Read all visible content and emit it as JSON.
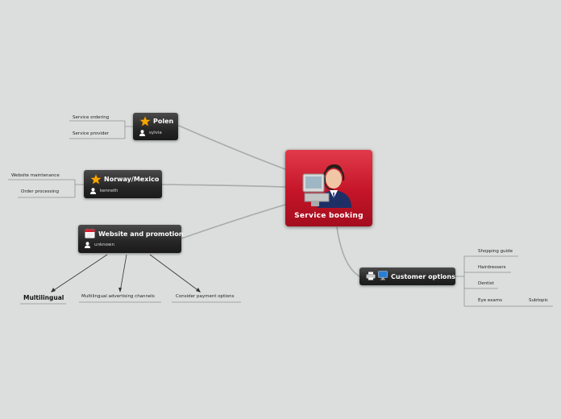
{
  "center": {
    "title": "Service  booking",
    "icon": "customer-support-operator-icon"
  },
  "topics": {
    "polen": {
      "title": "Polen",
      "person": "sylvia",
      "icon": "star-icon"
    },
    "norway": {
      "title": "Norway/Mexico",
      "person": "kenneth",
      "icon": "star-icon"
    },
    "website": {
      "title": "Website and promotion",
      "person": "unknown",
      "icon": "calendar-icon"
    },
    "customer": {
      "title": "Customer options",
      "icon": "printer-and-monitor-icon"
    }
  },
  "leaves": {
    "service_ordering": "Service ordering",
    "service_provider": "Service provider",
    "website_maintenance": "Website maintenance",
    "order_processing": "Order processing",
    "multilingual": "Multilingual",
    "multilingual_channels": "Multilingual advertising channels",
    "consider_payment": "Consider payment options",
    "shopping_guide": "Shopping guide",
    "hairdressers": "Hairdressers",
    "dentist": "Dentist",
    "eye_exams": "Eye exams",
    "subtopic": "Subtopic"
  },
  "colors": {
    "background": "#dcdedd",
    "center": "#c41528",
    "topic": "#2b2b2b",
    "star": "#f5a800"
  }
}
